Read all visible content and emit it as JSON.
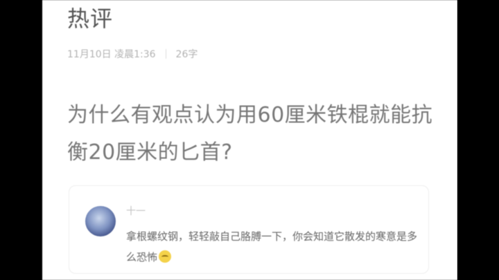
{
  "header": {
    "title": "热评"
  },
  "meta": {
    "datetime": "11月10日 凌晨1:36",
    "word_count": "26字"
  },
  "question": {
    "text": "为什么有观点认为用60厘米铁棍就能抗衡20厘米的匕首?"
  },
  "comment": {
    "username": "十一",
    "text": "拿根螺纹钢，轻轻敲自己胳膊一下，你会知道它散发的寒意是多么恐怖",
    "emoji": "sweat-smile-emoji"
  },
  "colors": {
    "letterbox": "#000000",
    "page_bg": "#ffffff",
    "title_text": "#555555",
    "meta_text": "#b3b3b3",
    "question_text": "#777777",
    "comment_text": "#666666"
  }
}
